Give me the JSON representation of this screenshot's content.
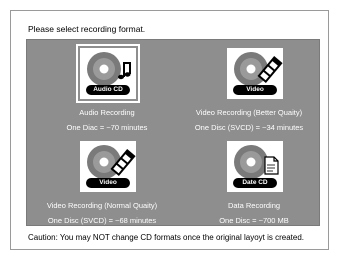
{
  "instruction": "Please select recording format.",
  "options": [
    {
      "badge": "Audio CD",
      "icon": "music-note-icon",
      "title": "Audio Recording",
      "capacity": "One Diac  =  ~70 minutes"
    },
    {
      "badge": "Video",
      "icon": "film-strip-icon",
      "title": "Video Recording (Better Quaity)",
      "capacity": "One Disc (SVCD)  =  ~34 minutes"
    },
    {
      "badge": "Video",
      "icon": "film-strip-icon",
      "title": "Video Recording (Normal Quaity)",
      "capacity": "One Disc (SVCD)  =  ~68 minutes"
    },
    {
      "badge": "Date CD",
      "icon": "document-icon",
      "title": "Data Recording",
      "capacity": "One Disc  =  ~700 MB"
    }
  ],
  "caution": "Caution: You may NOT change CD formats once the original layoyt is created.",
  "colors": {
    "panel": "#8e8e8e",
    "badge": "#000000",
    "label": "#ffffff"
  }
}
